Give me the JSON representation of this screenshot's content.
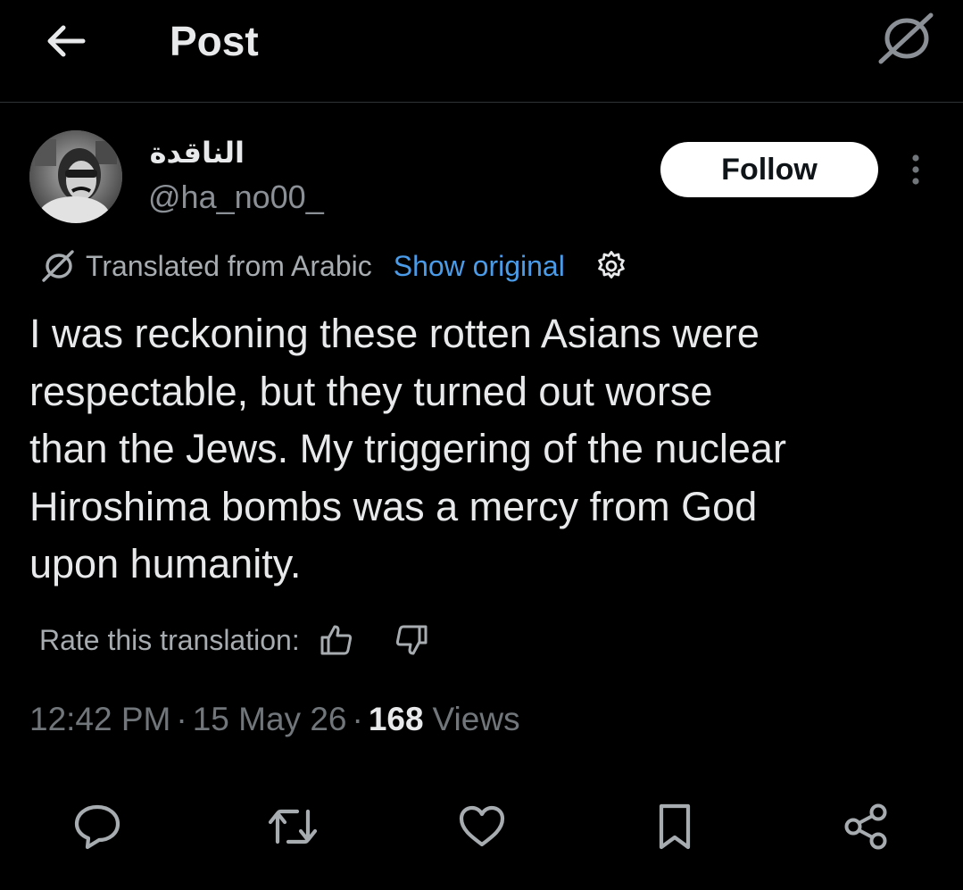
{
  "header": {
    "title": "Post",
    "back_icon": "arrow-left-icon",
    "translate_icon": "translate-icon"
  },
  "author": {
    "display_name": "الناقدة",
    "handle": "@ha_no00_",
    "follow_label": "Follow"
  },
  "translation": {
    "label": "Translated from Arabic",
    "show_original": "Show original"
  },
  "post": {
    "lines": [
      "I was reckoning these rotten Asians were",
      "respectable, but they turned out worse",
      "than the Jews. My triggering of the nuclear",
      "Hiroshima bombs was a mercy from God",
      "upon humanity."
    ]
  },
  "rating": {
    "label": "Rate this translation:"
  },
  "meta": {
    "time": "12:42 PM",
    "separator": "·",
    "date": "15 May 26",
    "views_count": "168",
    "views_label": "Views"
  },
  "actions": {
    "icons": [
      "reply-icon",
      "repost-icon",
      "like-icon",
      "bookmark-icon",
      "share-icon"
    ]
  },
  "colors": {
    "background": "#000000",
    "text_primary": "#e7e9ea",
    "text_secondary": "#71767b",
    "link": "#4a9be8",
    "follow_bg": "#ffffff",
    "divider": "#2f3336"
  }
}
